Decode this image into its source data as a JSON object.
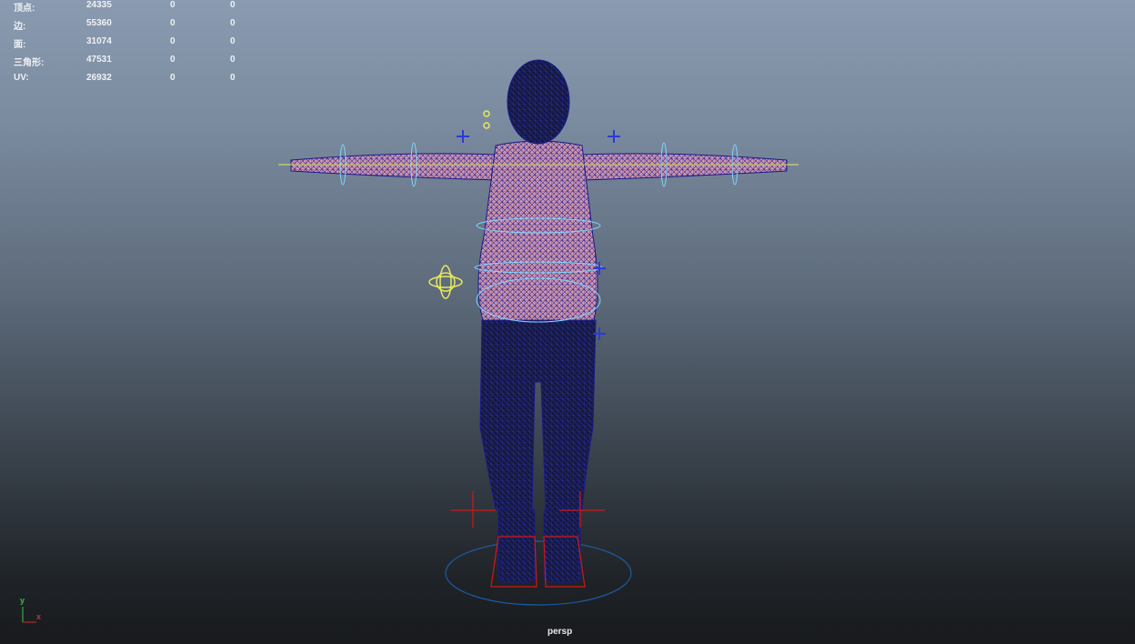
{
  "stats": [
    {
      "label": "顶点:",
      "value": "24335",
      "sel": "0",
      "tri": "0"
    },
    {
      "label": "边:",
      "value": "55360",
      "sel": "0",
      "tri": "0"
    },
    {
      "label": "面:",
      "value": "31074",
      "sel": "0",
      "tri": "0"
    },
    {
      "label": "三角形:",
      "value": "47531",
      "sel": "0",
      "tri": "0"
    },
    {
      "label": "UV:",
      "value": "26932",
      "sel": "0",
      "tri": "0"
    }
  ],
  "camera_name": "persp",
  "axis": {
    "y": "y",
    "x": "x"
  },
  "colors": {
    "wire": "#1a1a8c",
    "skin": "#d79aa8",
    "control": "#7fd6ff",
    "joint": "#e8e85a",
    "foot": "#d01818"
  }
}
